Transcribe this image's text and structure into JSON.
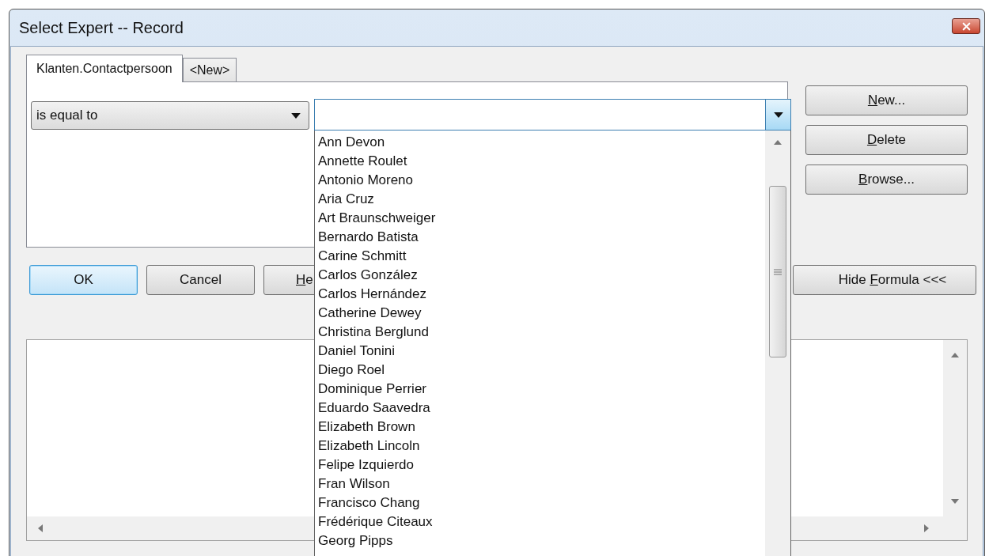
{
  "window": {
    "title": "Select Expert -- Record"
  },
  "tabs": [
    {
      "label": "Klanten.Contactpersoon",
      "selected": true
    },
    {
      "label": "<New>",
      "selected": false
    }
  ],
  "operator": {
    "value": "is equal to"
  },
  "value_field": {
    "open": true
  },
  "options": [
    "Ann Devon",
    "Annette Roulet",
    "Antonio Moreno",
    "Aria Cruz",
    "Art Braunschweiger",
    "Bernardo Batista",
    "Carine Schmitt",
    "Carlos González",
    "Carlos Hernández",
    "Catherine Dewey",
    "Christina Berglund",
    "Daniel Tonini",
    "Diego Roel",
    "Dominique Perrier",
    "Eduardo Saavedra",
    "Elizabeth Brown",
    "Elizabeth Lincoln",
    "Felipe Izquierdo",
    "Fran Wilson",
    "Francisco Chang",
    "Frédérique Citeaux",
    "Georg Pipps"
  ],
  "side_buttons": [
    {
      "parts": [
        {
          "text": "N",
          "underline": true
        },
        {
          "text": "ew...",
          "underline": false
        }
      ]
    },
    {
      "parts": [
        {
          "text": "D",
          "underline": true
        },
        {
          "text": "elete",
          "underline": false
        }
      ]
    },
    {
      "parts": [
        {
          "text": "B",
          "underline": true
        },
        {
          "text": "rowse...",
          "underline": false
        }
      ]
    }
  ],
  "bottom_buttons": [
    {
      "kind": "ok",
      "focused": true,
      "parts": [
        {
          "text": "OK",
          "underline": false
        }
      ]
    },
    {
      "kind": "cancel",
      "focused": false,
      "parts": [
        {
          "text": "Cancel",
          "underline": false
        }
      ]
    },
    {
      "kind": "help",
      "focused": false,
      "parts": [
        {
          "text": "H",
          "underline": true
        },
        {
          "text": "e",
          "underline": false
        }
      ]
    },
    {
      "kind": "formula",
      "focused": false,
      "parts": [
        {
          "text": "Hide ",
          "underline": false
        },
        {
          "text": "F",
          "underline": true
        },
        {
          "text": "ormula <<<",
          "underline": false
        }
      ]
    }
  ]
}
